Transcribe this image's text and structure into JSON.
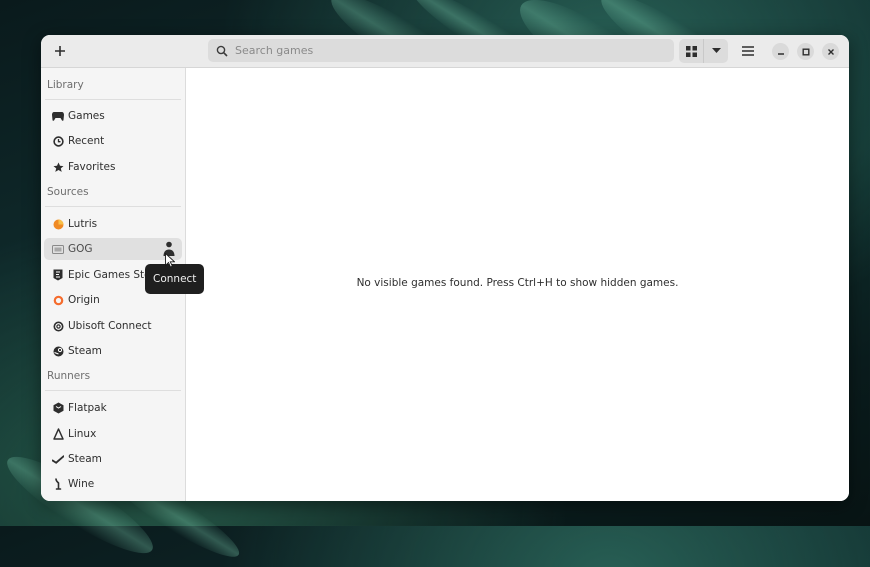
{
  "header": {
    "add_icon": "plus-icon",
    "search": {
      "placeholder": "Search games",
      "value": "",
      "icon": "search-icon"
    },
    "view_icons": [
      "grid-view-icon",
      "chevron-down-icon"
    ],
    "menu_icon": "hamburger-menu-icon",
    "window_controls": [
      "minimize-icon",
      "maximize-icon",
      "close-icon"
    ]
  },
  "sidebar": {
    "sections": [
      {
        "label": "Library",
        "items": [
          {
            "label": "Games",
            "icon": "gamepad-icon"
          },
          {
            "label": "Recent",
            "icon": "clock-icon"
          },
          {
            "label": "Favorites",
            "icon": "star-icon"
          }
        ]
      },
      {
        "label": "Sources",
        "items": [
          {
            "label": "Lutris",
            "icon": "lutris-icon"
          },
          {
            "label": "GOG",
            "icon": "gog-icon",
            "selected": true,
            "action_icon": "connect-person-icon"
          },
          {
            "label": "Epic Games Store",
            "icon": "epic-games-icon"
          },
          {
            "label": "Origin",
            "icon": "origin-icon"
          },
          {
            "label": "Ubisoft Connect",
            "icon": "ubisoft-icon"
          },
          {
            "label": "Steam",
            "icon": "steam-icon"
          }
        ]
      },
      {
        "label": "Runners",
        "items": [
          {
            "label": "Flatpak",
            "icon": "flatpak-icon"
          },
          {
            "label": "Linux",
            "icon": "linux-icon"
          },
          {
            "label": "Steam",
            "icon": "steam-runner-icon"
          },
          {
            "label": "Wine",
            "icon": "wine-icon"
          }
        ]
      }
    ]
  },
  "tooltip": {
    "text": "Connect"
  },
  "content": {
    "empty_message": "No visible games found. Press Ctrl+H to show hidden games."
  },
  "colors": {
    "accent_lutris": "#f08a24",
    "accent_origin": "#f56c2d",
    "sidebar_bg": "#f5f5f5",
    "selected_bg": "#e0e0e0"
  }
}
